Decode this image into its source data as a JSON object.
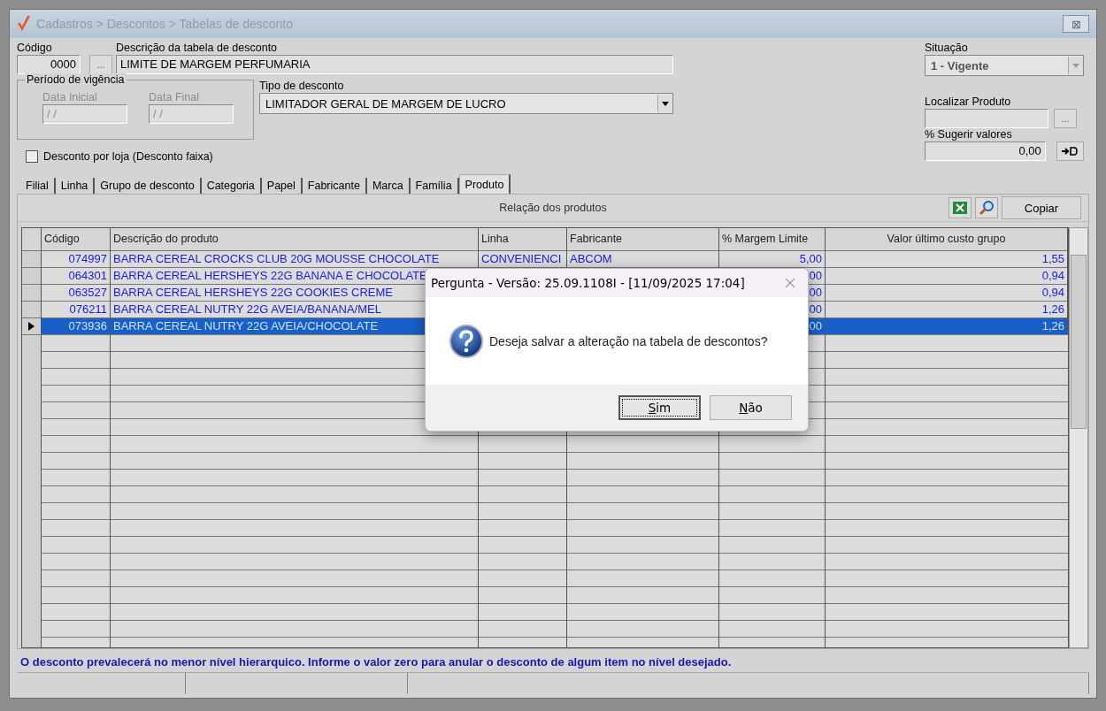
{
  "window": {
    "title": "Cadastros > Descontos > Tabelas de desconto",
    "close": "⊠"
  },
  "form": {
    "codigo": {
      "label": "Código",
      "value": "0000",
      "browse": "..."
    },
    "descricao": {
      "label": "Descrição da tabela de desconto",
      "value": "LIMITE DE MARGEM PERFUMARIA"
    },
    "situacao": {
      "label": "Situação",
      "value": "1 - Vigente"
    },
    "periodo": {
      "legend": "Período de vigência",
      "data_inicial": {
        "label": "Data Inicial",
        "value": "/ /"
      },
      "data_final": {
        "label": "Data Final",
        "value": "/ /"
      }
    },
    "tipo": {
      "label": "Tipo de desconto",
      "value": "LIMITADOR GERAL DE MARGEM DE LUCRO"
    },
    "localizar": {
      "label": "Localizar Produto",
      "browse": "..."
    },
    "sugerir": {
      "label": "% Sugerir valores",
      "value": "0,00"
    },
    "desconto_por_loja": {
      "label": "Desconto por loja (Desconto faixa)",
      "checked": false
    }
  },
  "tabs": [
    {
      "label": "Filial",
      "selected": false
    },
    {
      "label": "Linha",
      "selected": false
    },
    {
      "label": "Grupo de desconto",
      "selected": false
    },
    {
      "label": "Categoria",
      "selected": false
    },
    {
      "label": "Papel",
      "selected": false
    },
    {
      "label": "Fabricante",
      "selected": false
    },
    {
      "label": "Marca",
      "selected": false
    },
    {
      "label": "Família",
      "selected": false
    },
    {
      "label": "Produto",
      "selected": true
    }
  ],
  "panel": {
    "title": "Relação dos produtos",
    "copy_button": "Copiar"
  },
  "table": {
    "columns": [
      "Código",
      "Descrição do produto",
      "Linha",
      "Fabricante",
      "% Margem Limite",
      "Valor último custo grupo"
    ],
    "rows": [
      {
        "codigo": "074997",
        "descricao": "BARRA CEREAL CROCKS CLUB 20G MOUSSE CHOCOLATE",
        "linha": "CONVENIENCI",
        "fabricante": "ABCOM",
        "margem": "5,00",
        "valor": "1,55",
        "selected": false
      },
      {
        "codigo": "064301",
        "descricao": "BARRA CEREAL HERSHEYS 22G BANANA E CHOCOLATE",
        "linha": "",
        "fabricante": "",
        "margem": "00",
        "valor": "0,94",
        "selected": false
      },
      {
        "codigo": "063527",
        "descricao": "BARRA CEREAL HERSHEYS 22G COOKIES CREME",
        "linha": "",
        "fabricante": "",
        "margem": "00",
        "valor": "0,94",
        "selected": false
      },
      {
        "codigo": "076211",
        "descricao": "BARRA CEREAL NUTRY 22G AVEIA/BANANA/MEL",
        "linha": "",
        "fabricante": "",
        "margem": "00",
        "valor": "1,26",
        "selected": false
      },
      {
        "codigo": "073936",
        "descricao": "BARRA CEREAL NUTRY 22G AVEIA/CHOCOLATE",
        "linha": "",
        "fabricante": "",
        "margem": "00",
        "valor": "1,26",
        "selected": true
      }
    ]
  },
  "footer_message": "O desconto prevalecerá no menor nível hierarquico. Informe o valor zero para anular o desconto de algum item no nível desejado.",
  "dialog": {
    "title": "Pergunta - Versão: 25.09.1108I - [11/09/2025 17:04]",
    "message": "Deseja salvar a alteração na tabela de descontos?",
    "buttons": [
      {
        "label": "**S**im",
        "focused": true
      },
      {
        "label": "**N**ão",
        "focused": false
      }
    ]
  }
}
